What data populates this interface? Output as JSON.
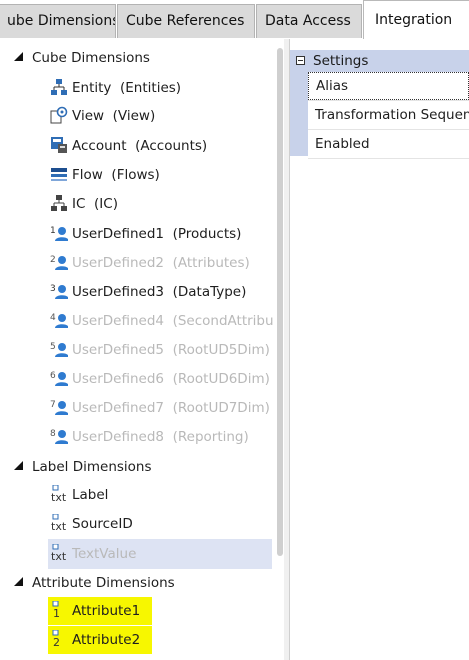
{
  "tabs": [
    {
      "label": "ube Dimensions"
    },
    {
      "label": "Cube References"
    },
    {
      "label": "Data Access"
    },
    {
      "label": "Integration"
    }
  ],
  "tree": {
    "cube_dimensions": {
      "label": "Cube Dimensions",
      "items": [
        {
          "label": "Entity",
          "detail": "(Entities)",
          "icon": "entity-hierarchy-icon"
        },
        {
          "label": "View",
          "detail": "(View)",
          "icon": "view-icon"
        },
        {
          "label": "Account",
          "detail": "(Accounts)",
          "icon": "account-icon"
        },
        {
          "label": "Flow",
          "detail": "(Flows)",
          "icon": "flow-icon"
        },
        {
          "label": "IC",
          "detail": "(IC)",
          "icon": "ic-hierarchy-icon"
        },
        {
          "label": "UserDefined1",
          "detail": "(Products)",
          "icon": "user-defined-icon",
          "num": "1"
        },
        {
          "label": "UserDefined2",
          "detail": "(Attributes)",
          "icon": "user-defined-icon",
          "num": "2"
        },
        {
          "label": "UserDefined3",
          "detail": "(DataType)",
          "icon": "user-defined-icon",
          "num": "3"
        },
        {
          "label": "UserDefined4",
          "detail": "(SecondAttribu",
          "icon": "user-defined-icon",
          "num": "4"
        },
        {
          "label": "UserDefined5",
          "detail": "(RootUD5Dim)",
          "icon": "user-defined-icon",
          "num": "5"
        },
        {
          "label": "UserDefined6",
          "detail": "(RootUD6Dim)",
          "icon": "user-defined-icon",
          "num": "6"
        },
        {
          "label": "UserDefined7",
          "detail": "(RootUD7Dim)",
          "icon": "user-defined-icon",
          "num": "7"
        },
        {
          "label": "UserDefined8",
          "detail": "(Reporting)",
          "icon": "user-defined-icon",
          "num": "8"
        }
      ]
    },
    "label_dimensions": {
      "label": "Label Dimensions",
      "items": [
        {
          "label": "Label",
          "icon": "txt-icon"
        },
        {
          "label": "SourceID",
          "icon": "txt-icon"
        },
        {
          "label": "TextValue",
          "icon": "txt-icon"
        }
      ]
    },
    "attribute_dimensions": {
      "label": "Attribute Dimensions",
      "items": [
        {
          "label": "Attribute1",
          "icon": "attribute-icon",
          "num": "1"
        },
        {
          "label": "Attribute2",
          "icon": "attribute-icon",
          "num": "2"
        }
      ]
    }
  },
  "properties": {
    "category": "Settings",
    "rows": [
      {
        "label": "Alias"
      },
      {
        "label": "Transformation Sequen"
      },
      {
        "label": "Enabled"
      }
    ]
  },
  "icons": {
    "txt_glyph": "txt",
    "minus_glyph": "−"
  },
  "colors": {
    "highlight": "#f7f700",
    "selection": "#dde3f3",
    "disabled_text": "#b9b9b9",
    "settings_header": "#c8d2ea"
  }
}
